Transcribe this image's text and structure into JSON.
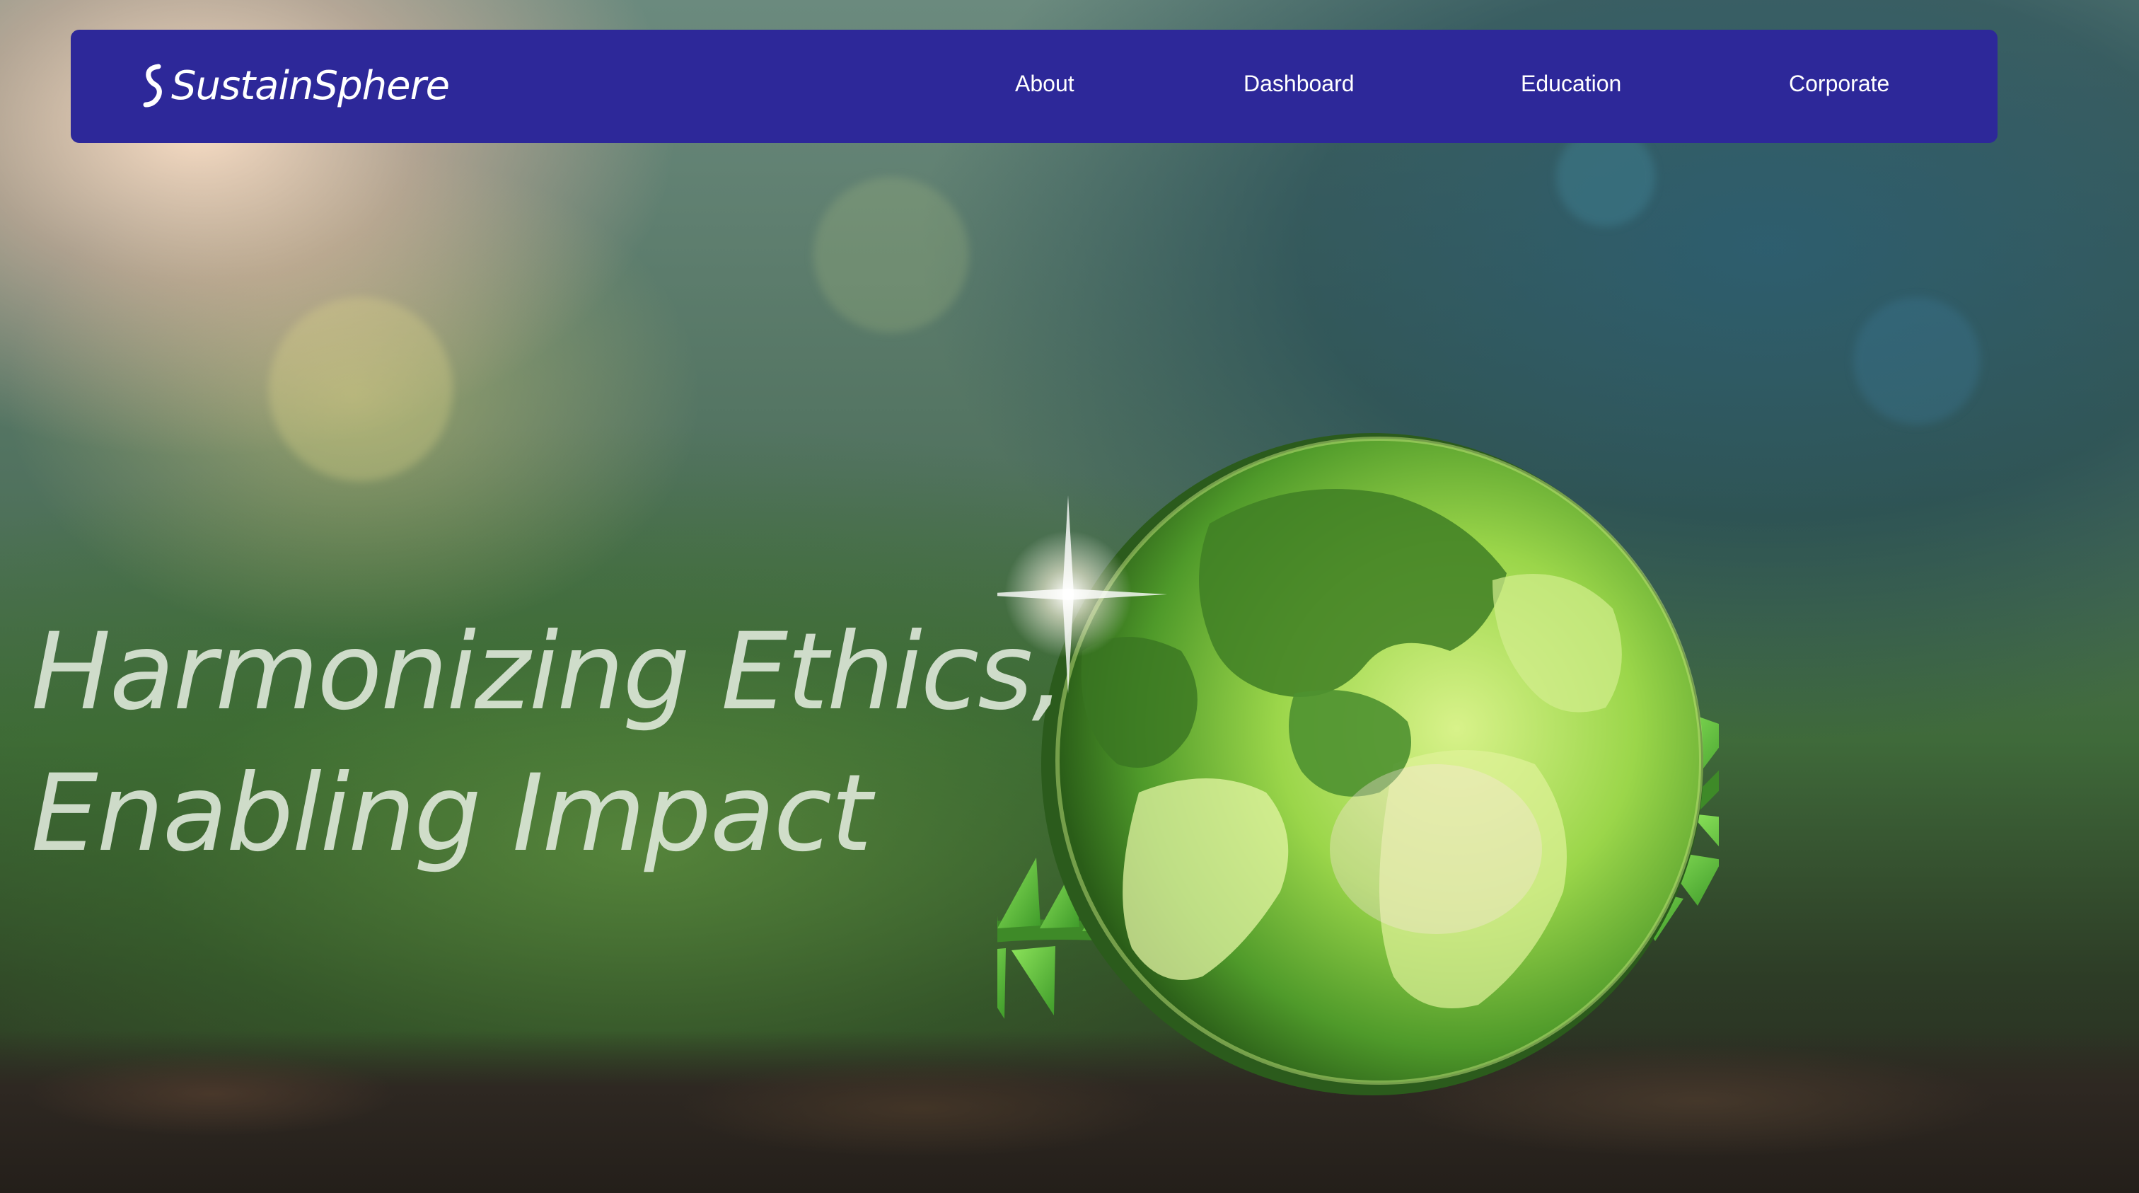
{
  "brand": {
    "name": "SustainSphere",
    "icon": "brand-s-icon"
  },
  "nav": {
    "items": [
      {
        "label": "About"
      },
      {
        "label": "Dashboard"
      },
      {
        "label": "Education"
      },
      {
        "label": "Corporate"
      }
    ]
  },
  "hero": {
    "headline_line1": "Harmonizing Ethics,",
    "headline_line2": "Enabling Impact",
    "image": "glass-globe-on-soil-with-fern-image"
  },
  "colors": {
    "navbar": "#2d2899",
    "nav_text": "#ffffff",
    "headline_text": "#e2ecde"
  }
}
